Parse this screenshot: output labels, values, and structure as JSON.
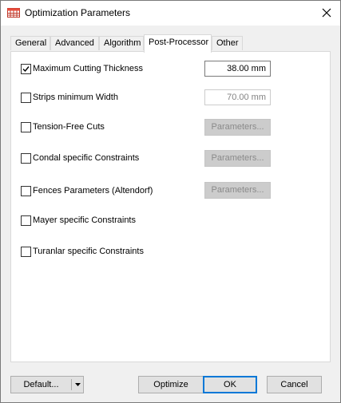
{
  "window": {
    "title": "Optimization Parameters",
    "icon": "grid-table-icon",
    "close_icon": "close-icon"
  },
  "tabs": [
    {
      "label": "General"
    },
    {
      "label": "Advanced"
    },
    {
      "label": "Algorithm"
    },
    {
      "label": "Post-Processor",
      "active": true
    },
    {
      "label": "Other"
    }
  ],
  "options": [
    {
      "label": "Maximum Cutting Thickness",
      "checked": true,
      "value": "38.00 mm",
      "value_enabled": true
    },
    {
      "label": "Strips minimum Width",
      "checked": false,
      "value": "70.00 mm",
      "value_enabled": false
    },
    {
      "label": "Tension-Free Cuts",
      "checked": false,
      "button": "Parameters..."
    },
    {
      "label": "Condal specific Constraints",
      "checked": false,
      "button": "Parameters..."
    },
    {
      "label": "Fences Parameters (Altendorf)",
      "checked": false,
      "button": "Parameters..."
    },
    {
      "label": "Mayer specific Constraints",
      "checked": false
    },
    {
      "label": "Turanlar specific Constraints",
      "checked": false
    }
  ],
  "footer": {
    "default_label": "Default...",
    "optimize_label": "Optimize",
    "ok_label": "OK",
    "cancel_label": "Cancel"
  },
  "colors": {
    "accent": "#0078d7",
    "disabled_button_bg": "#cccccc",
    "disabled_text": "#838383"
  }
}
